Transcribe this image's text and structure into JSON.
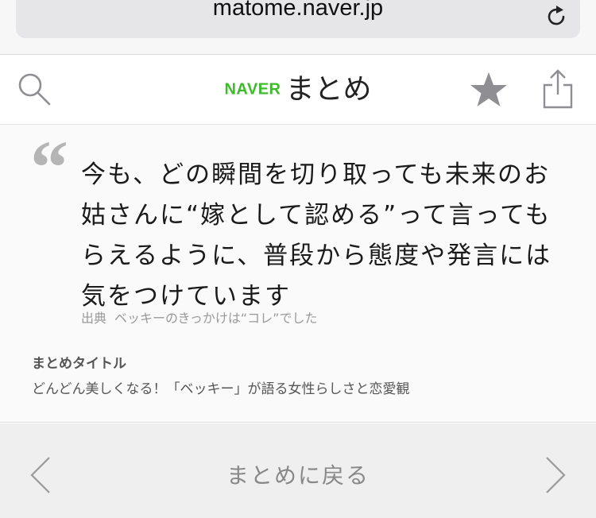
{
  "browser": {
    "url": "matome.naver.jp"
  },
  "header": {
    "logo_brand": "NAVER",
    "logo_title": "まとめ"
  },
  "quote": {
    "text": "今も、どの瞬間を切り取っても未来のお姑さんに“嫁として認める”って言ってもらえるように、普段から態度や発言には気をつけています",
    "source_label": "出典",
    "source_text": "ベッキーのきっかけは“コレ”でした"
  },
  "matome": {
    "title_label": "まとめタイトル",
    "title_text": "どんどん美しくなる！「ベッキー」が語る女性らしさと恋愛観"
  },
  "footer": {
    "back_label": "まとめに戻る"
  },
  "colors": {
    "naver_green": "#3dbb2b",
    "icon_gray": "#8e8e93",
    "quote_gray": "#b5b5b5"
  }
}
